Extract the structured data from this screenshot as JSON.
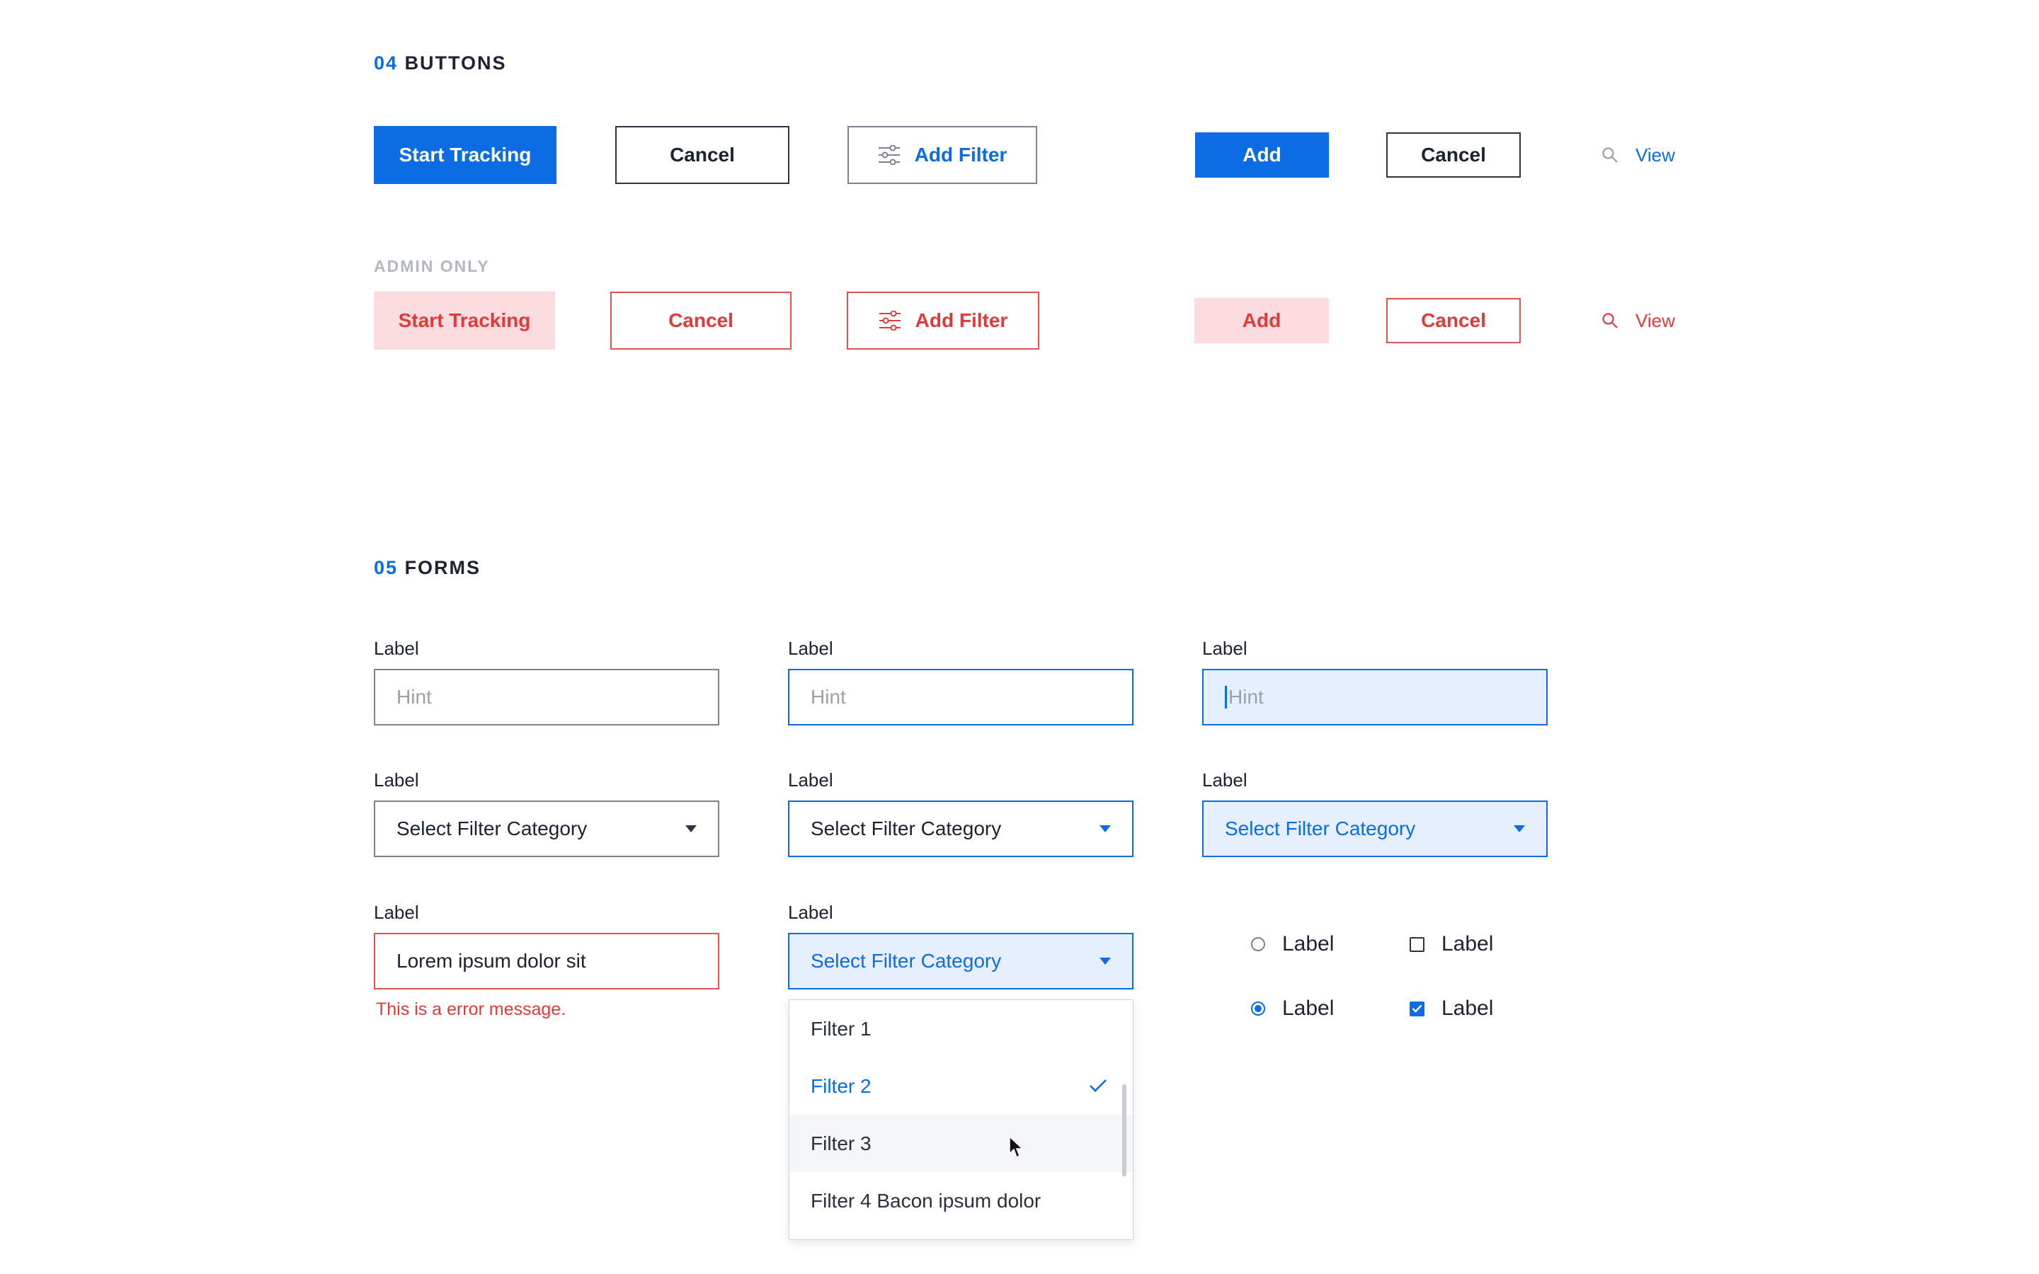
{
  "buttons_section": {
    "number": "04",
    "title": "BUTTONS",
    "standard": {
      "start_tracking": "Start Tracking",
      "cancel": "Cancel",
      "add_filter": "Add Filter",
      "add": "Add",
      "cancel_small": "Cancel",
      "view": "View"
    },
    "admin_label": "ADMIN ONLY",
    "admin": {
      "start_tracking": "Start Tracking",
      "cancel": "Cancel",
      "add_filter": "Add Filter",
      "add": "Add",
      "cancel_small": "Cancel",
      "view": "View"
    }
  },
  "forms_section": {
    "number": "05",
    "title": "FORMS",
    "text_fields": [
      {
        "label": "Label",
        "placeholder": "Hint",
        "state": "default"
      },
      {
        "label": "Label",
        "placeholder": "Hint",
        "state": "focus"
      },
      {
        "label": "Label",
        "placeholder": "Hint",
        "state": "active-typing"
      }
    ],
    "selects": [
      {
        "label": "Label",
        "value": "Select Filter Category",
        "state": "default"
      },
      {
        "label": "Label",
        "value": "Select Filter Category",
        "state": "focus"
      },
      {
        "label": "Label",
        "value": "Select Filter Category",
        "state": "active"
      }
    ],
    "error_field": {
      "label": "Label",
      "value": "Lorem ipsum dolor sit",
      "error_message": "This is a error message."
    },
    "open_select": {
      "label": "Label",
      "value": "Select Filter Category",
      "options": [
        "Filter 1",
        "Filter 2",
        "Filter 3",
        "Filter 4 Bacon ipsum dolor"
      ],
      "selected_option": "Filter 2",
      "hovered_option": "Filter 3"
    },
    "radios": [
      {
        "label": "Label",
        "checked": false
      },
      {
        "label": "Label",
        "checked": true
      }
    ],
    "checkboxes": [
      {
        "label": "Label",
        "checked": false
      },
      {
        "label": "Label",
        "checked": true
      }
    ]
  },
  "colors": {
    "primary": "#0b6ce3",
    "primary_light": "#e6effd",
    "error": "#e03b3b",
    "error_light": "#fcdcdf",
    "admin_label": "#b3b8c0",
    "text": "#1b2230"
  },
  "icons": {
    "filter": "sliders-icon",
    "view": "search-icon",
    "selected_option": "checkmark-icon",
    "select": "caret-down-icon"
  }
}
